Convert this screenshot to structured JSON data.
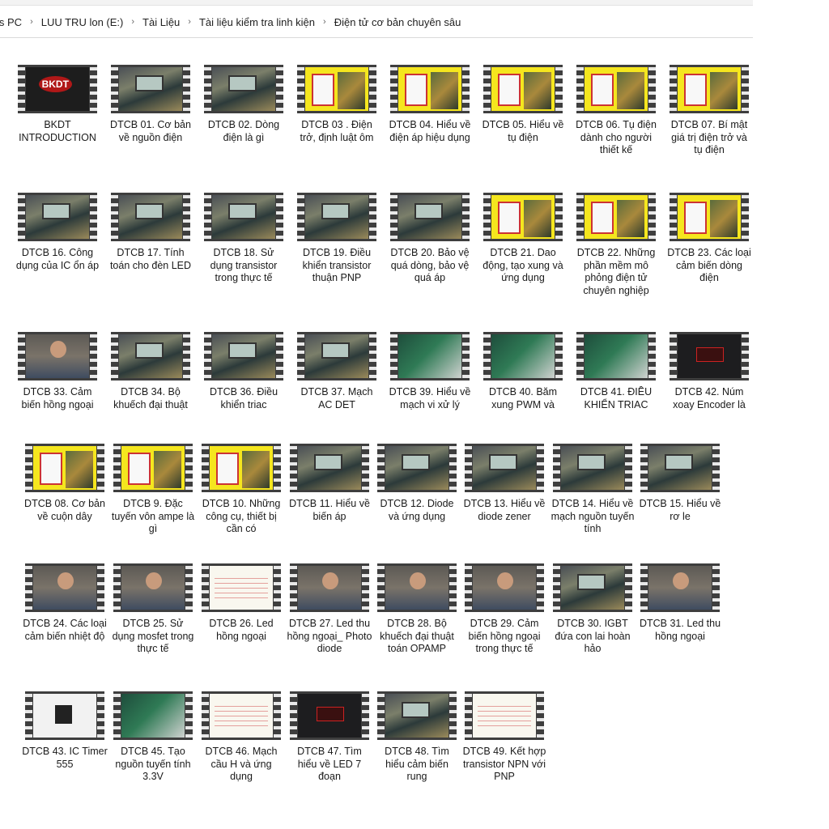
{
  "address": {
    "crumbs": [
      "is PC",
      "LUU TRU lon (E:)",
      "Tài Liệu",
      "Tài liệu kiểm tra linh kiện",
      "Điện tử cơ bản chuyên sâu"
    ]
  },
  "files": [
    {
      "label": "BKDT INTRODUCTION"
    },
    {
      "label": "DTCB 01. Cơ bản về nguồn điện"
    },
    {
      "label": "DTCB 02. Dòng điện là gì"
    },
    {
      "label": "DTCB 03 . Điện trở, định luật ôm"
    },
    {
      "label": "DTCB 04. Hiểu về điện áp hiệu dụng"
    },
    {
      "label": "DTCB 05. Hiểu về tụ điện"
    },
    {
      "label": "DTCB 06. Tụ điện dành cho người thiết kế"
    },
    {
      "label": "DTCB 07. Bí mật giá trị điện trở và tụ điện"
    },
    {
      "label": "DTCB 16. Công dụng của IC ổn áp"
    },
    {
      "label": "DTCB 17. Tính toán cho đèn LED"
    },
    {
      "label": "DTCB 18. Sử dụng transistor trong thực tế"
    },
    {
      "label": "DTCB 19. Điều khiển transistor thuận PNP"
    },
    {
      "label": "DTCB 20. Bảo vệ quá dòng, bảo vệ quá áp"
    },
    {
      "label": "DTCB 21. Dao động, tạo xung và ứng dụng"
    },
    {
      "label": "DTCB 22. Những phần mềm mô phỏng điện tử chuyên nghiệp"
    },
    {
      "label": "DTCB 23. Các loại cảm biến dòng điện"
    },
    {
      "label": "DTCB 33. Cảm biến hồng ngoại"
    },
    {
      "label": "DTCB 34. Bộ khuếch đại thuật"
    },
    {
      "label": "DTCB 36. Điều khiển triac"
    },
    {
      "label": "DTCB 37. Mạch AC DET"
    },
    {
      "label": "DTCB 39. Hiểu về mạch vi xử lý"
    },
    {
      "label": "DTCB 40. Băm xung PWM và"
    },
    {
      "label": "DTCB 41. ĐIỀU KHIỂN TRIAC"
    },
    {
      "label": "DTCB 42. Núm xoay Encoder là"
    },
    {
      "label": "DTCB 08. Cơ bản về cuộn dây"
    },
    {
      "label": "DTCB 9. Đặc tuyến vôn ampe là gì"
    },
    {
      "label": "DTCB 10. Những công cụ, thiết bị cần có"
    },
    {
      "label": "DTCB 11. Hiểu về biến áp"
    },
    {
      "label": "DTCB 12. Diode và ứng dụng"
    },
    {
      "label": "DTCB 13. Hiểu về diode zener"
    },
    {
      "label": "DTCB 14. Hiểu về mạch nguồn tuyến tính"
    },
    {
      "label": "DTCB 15. Hiểu về rơ le"
    },
    {
      "label": "DTCB 24. Các loại cảm biến nhiệt độ"
    },
    {
      "label": "DTCB 25. Sử dụng mosfet trong thực tế"
    },
    {
      "label": "DTCB 26. Led hồng ngoại"
    },
    {
      "label": "DTCB 27. Led thu hồng ngoại_ Photo diode"
    },
    {
      "label": "DTCB 28. Bộ khuếch đại thuật toán OPAMP"
    },
    {
      "label": "DTCB 29. Cảm biến hồng ngoại trong thực tế"
    },
    {
      "label": "DTCB 30. IGBT đứa con lai hoàn hảo"
    },
    {
      "label": "DTCB 31. Led thu hồng ngoại"
    },
    {
      "label": "DTCB 43. IC Timer 555"
    },
    {
      "label": "DTCB 45. Tạo nguồn tuyến tính 3.3V"
    },
    {
      "label": "DTCB 46. Mạch cầu H và ứng dụng"
    },
    {
      "label": "DTCB 47. Tìm hiểu về LED 7 đoạn"
    },
    {
      "label": "DTCB 48. Tìm hiểu cảm biến rung"
    },
    {
      "label": "DTCB 49. Kết hợp transistor NPN với PNP"
    }
  ],
  "thumb_styles": [
    "title",
    "bench",
    "bench",
    "yellow",
    "yellow",
    "yellow",
    "yellow",
    "yellow",
    "bench",
    "bench",
    "bench",
    "bench",
    "bench",
    "yellow",
    "yellow",
    "yellow",
    "person",
    "bench",
    "bench",
    "bench",
    "board",
    "board",
    "board",
    "dark",
    "yellow",
    "yellow",
    "yellow",
    "bench",
    "bench",
    "bench",
    "bench",
    "bench",
    "person",
    "person",
    "paper",
    "person",
    "person",
    "person",
    "bench",
    "person",
    "ic",
    "board",
    "paper",
    "dark",
    "bench",
    "paper"
  ]
}
